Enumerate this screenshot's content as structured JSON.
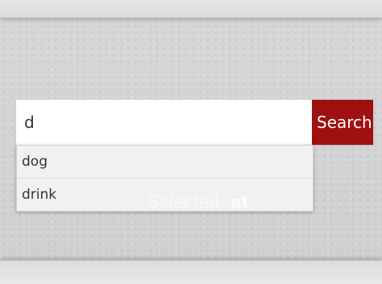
{
  "search": {
    "value": "d",
    "button_label": "Search"
  },
  "suggestions": [
    {
      "label": "dog"
    },
    {
      "label": "drink"
    }
  ],
  "status": {
    "label": "Selected:",
    "value": "at"
  },
  "colors": {
    "accent": "#9f1010",
    "page_background": "#d3d3d3"
  }
}
